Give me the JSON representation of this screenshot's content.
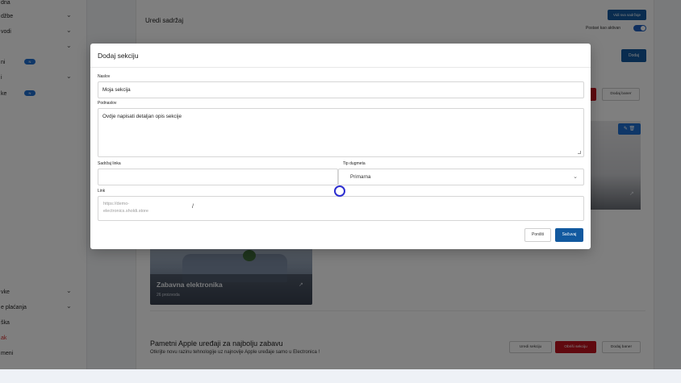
{
  "sidebar": {
    "items": [
      {
        "label": "dna",
        "chevron": false,
        "badge": "",
        "red": false
      },
      {
        "label": "džbe",
        "chevron": true,
        "badge": "",
        "red": false
      },
      {
        "label": "vodi",
        "chevron": true,
        "badge": "",
        "red": false
      },
      {
        "label": "",
        "chevron": true,
        "badge": "",
        "red": false
      },
      {
        "label": "ni",
        "chevron": false,
        "badge": "N",
        "red": false
      },
      {
        "label": "i",
        "chevron": true,
        "badge": "",
        "red": false
      },
      {
        "label": "ke",
        "chevron": false,
        "badge": "N",
        "red": false
      },
      {
        "label": "vke",
        "chevron": true,
        "badge": "",
        "red": false
      },
      {
        "label": "e plaćanja",
        "chevron": true,
        "badge": "",
        "red": false
      },
      {
        "label": "ška",
        "chevron": false,
        "badge": "",
        "red": false
      },
      {
        "label": "ak",
        "chevron": false,
        "badge": "",
        "red": true
      },
      {
        "label": "meni",
        "chevron": false,
        "badge": "",
        "red": false
      }
    ]
  },
  "page": {
    "title": "Uredi sadržaj",
    "view_all_button": "Vidi sva sadržaje",
    "toggle_label": "Postavi kao aktivan",
    "toggle_on": true
  },
  "background": {
    "add_button": "Dodaj",
    "banner_button": "Dodaj baner",
    "product_card": {
      "name": "Zabavna elektronika",
      "count": "26 proizvoda"
    },
    "section": {
      "title": "Pametni Apple uređaji za najbolju zabavu",
      "subtitle": "Otkrijte novu razinu tehnologije uz najnovije Apple uređaje samo u Electronica !",
      "edit_button": "Uredi sekciju",
      "delete_button": "Obriši sekciju",
      "banner_button": "Dodaj baner"
    }
  },
  "modal": {
    "title": "Dodaj sekciju",
    "fields": {
      "naslov_label": "Naslov",
      "naslov_value": "Moja sekcija",
      "podnaslov_label": "Podnaslov",
      "podnaslov_value": "Ovdje napisati detaljan opis sekcije",
      "sadrzaj_linka_label": "Sadržaj linka",
      "sadrzaj_linka_value": "",
      "tip_dugmeta_label": "Tip dugmeta",
      "tip_dugmeta_value": "Primarna",
      "link_label": "Link",
      "link_prefix": "https://demo-electronics.sholdi.store",
      "link_value": "/"
    },
    "cancel_button": "Poništi",
    "save_button": "Sačuvaj"
  },
  "colors": {
    "primary": "#12599f",
    "danger": "#c1121f",
    "badge": "#1f6fd1",
    "cursor": "#2d2fd0"
  }
}
